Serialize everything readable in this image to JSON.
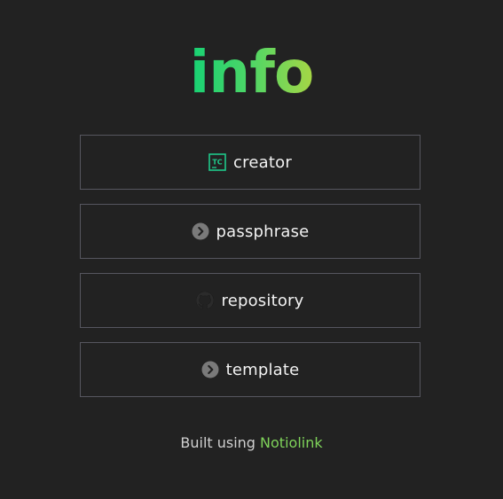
{
  "header": {
    "title": "info"
  },
  "links": [
    {
      "label": "creator",
      "icon": "tc-logo-icon"
    },
    {
      "label": "passphrase",
      "icon": "chevron-right-circle-icon"
    },
    {
      "label": "repository",
      "icon": "github-icon"
    },
    {
      "label": "template",
      "icon": "chevron-right-circle-icon"
    }
  ],
  "footer": {
    "prefix": "Built using",
    "brand": "Notiolink"
  },
  "colors": {
    "background": "#222222",
    "border": "#56565f",
    "text": "#f2f2f2",
    "accent_green": "#16d174",
    "accent_lime": "#a6d645",
    "icon_gray": "#7a7a7a"
  }
}
